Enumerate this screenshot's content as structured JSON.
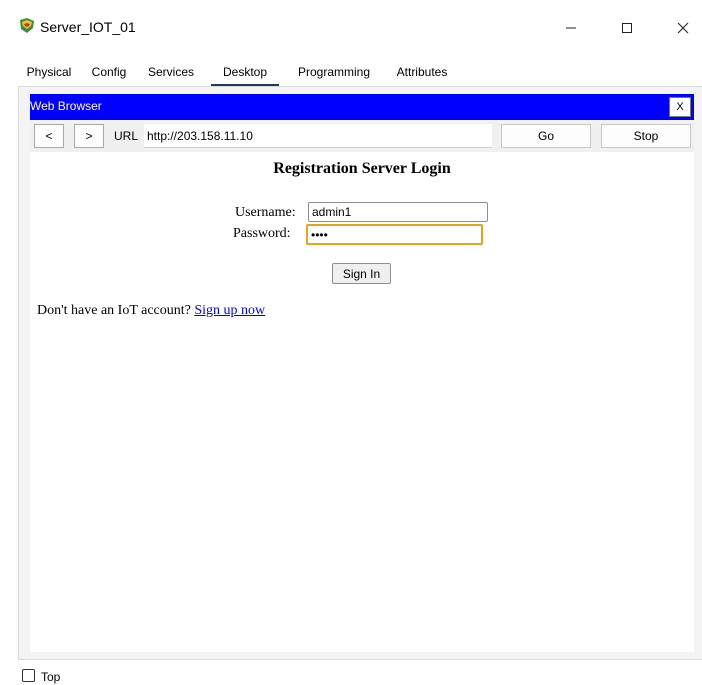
{
  "window": {
    "title": "Server_IOT_01",
    "icon": "packet-tracer-server-icon",
    "controls": [
      "minimize-icon",
      "maximize-icon",
      "close-icon"
    ]
  },
  "tabs": [
    {
      "label": "Physical",
      "active": false
    },
    {
      "label": "Config",
      "active": false
    },
    {
      "label": "Services",
      "active": false
    },
    {
      "label": "Desktop",
      "active": true
    },
    {
      "label": "Programming",
      "active": false
    },
    {
      "label": "Attributes",
      "active": false
    }
  ],
  "browser": {
    "title": "Web Browser",
    "close_label": "X",
    "back_label": "<",
    "forward_label": ">",
    "url_label": "URL",
    "url_value": "http://203.158.11.10",
    "go_label": "Go",
    "stop_label": "Stop"
  },
  "page": {
    "heading": "Registration Server Login",
    "username_label": "Username:",
    "username_value": "admin1",
    "password_label": "Password:",
    "password_value": "••••",
    "sign_in_label": "Sign In",
    "signup_text": "Don't have an IoT account?",
    "signup_link": "Sign up now"
  },
  "footer": {
    "top_label": "Top",
    "top_checked": false
  },
  "colors": {
    "browser_bar": "#0000ff",
    "focus_outline": "#e8a317",
    "link": "#0000ee",
    "active_tab_underline": "#1f3a5f"
  }
}
